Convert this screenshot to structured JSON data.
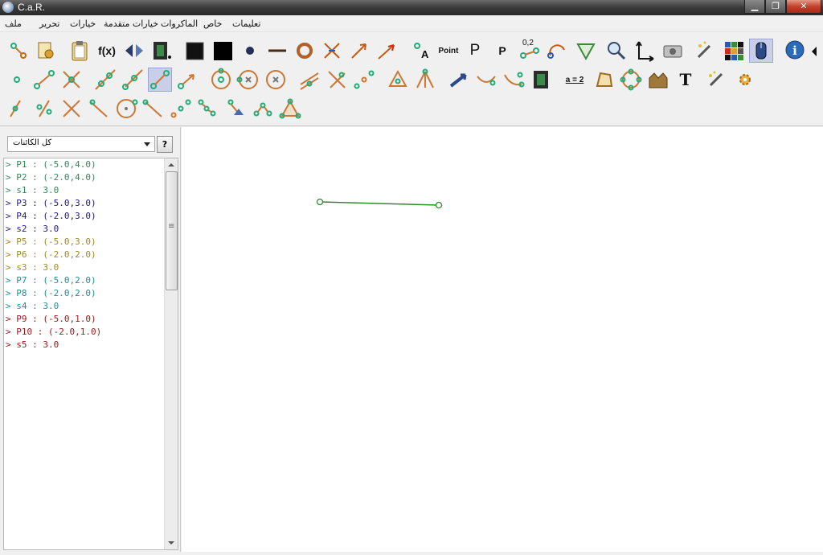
{
  "window": {
    "title": "C.a.R."
  },
  "menu": [
    "ملف",
    "تحرير",
    "خيارات",
    "خيارات متقدمة",
    "الماكروات",
    "خاص",
    "تعليمات"
  ],
  "toolbar": {
    "text_tools": {
      "fx": "f(x)",
      "point_label": "A",
      "point_word": "Point",
      "p_big": "P",
      "p_small": "P",
      "coord": "0,2",
      "a_eq": "a = 2",
      "text_tool": "T"
    }
  },
  "panel": {
    "filter": {
      "selected": "كل الكائنات"
    },
    "help": "?",
    "objects": [
      {
        "text": "> P1 : (-5.0,4.0)",
        "color": "#2e8b57"
      },
      {
        "text": "> P2 : (-2.0,4.0)",
        "color": "#2e8b57"
      },
      {
        "text": "> s1 : 3.0",
        "color": "#2e8b57"
      },
      {
        "text": "> P3 : (-5.0,3.0)",
        "color": "#1a1a8c"
      },
      {
        "text": "> P4 : (-2.0,3.0)",
        "color": "#1a1a8c"
      },
      {
        "text": "> s2 : 3.0",
        "color": "#1a1a8c"
      },
      {
        "text": "> P5 : (-5.0,3.0)",
        "color": "#a08a20"
      },
      {
        "text": "> P6 : (-2.0,2.0)",
        "color": "#a08a20"
      },
      {
        "text": "> s3 : 3.0",
        "color": "#a08a20"
      },
      {
        "text": "> P7 : (-5.0,2.0)",
        "color": "#1f8f9a"
      },
      {
        "text": "> P8 : (-2.0,2.0)",
        "color": "#1f8f9a"
      },
      {
        "text": "> s4 : 3.0",
        "color": "#1f8f9a"
      },
      {
        "text": "> P9 : (-5.0,1.0)",
        "color": "#a01818"
      },
      {
        "text": "> P10 : (-2.0,1.0)",
        "color": "#a01818"
      },
      {
        "text": "> s5 : 3.0",
        "color": "#a01818"
      }
    ]
  },
  "colors": {
    "segment": "#2e8b2e"
  }
}
